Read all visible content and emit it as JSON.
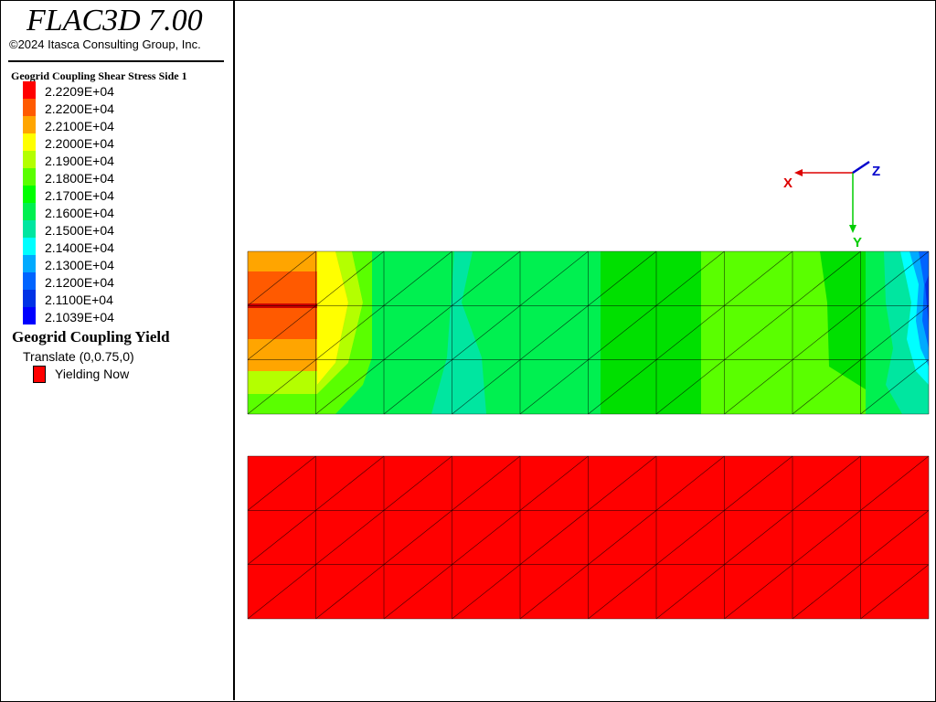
{
  "app": {
    "title": "FLAC3D 7.00",
    "copyright": "©2024 Itasca Consulting Group, Inc."
  },
  "contour_legend": {
    "heading": "Geogrid Coupling Shear Stress Side 1",
    "levels": [
      {
        "label": "2.2209E+04",
        "color": "#ff0000"
      },
      {
        "label": "2.2200E+04",
        "color": "#ff5a00"
      },
      {
        "label": "2.2100E+04",
        "color": "#ffa500"
      },
      {
        "label": "2.2000E+04",
        "color": "#ffff00"
      },
      {
        "label": "2.1900E+04",
        "color": "#b4ff00"
      },
      {
        "label": "2.1800E+04",
        "color": "#5aff00"
      },
      {
        "label": "2.1700E+04",
        "color": "#00ff00"
      },
      {
        "label": "2.1600E+04",
        "color": "#00f050"
      },
      {
        "label": "2.1500E+04",
        "color": "#00e6a0"
      },
      {
        "label": "2.1400E+04",
        "color": "#00ffff"
      },
      {
        "label": "2.1300E+04",
        "color": "#00aaff"
      },
      {
        "label": "2.1200E+04",
        "color": "#0064ff"
      },
      {
        "label": "2.1100E+04",
        "color": "#0032e6"
      },
      {
        "label": "2.1039E+04",
        "color": "#0000ff"
      }
    ]
  },
  "yield_legend": {
    "heading": "Geogrid Coupling Yield",
    "translate": "Translate (0,0.75,0)",
    "item_label": "Yielding Now",
    "item_color": "#ff0000"
  },
  "axes": {
    "x_label": "X",
    "y_label": "Y",
    "z_label": "Z",
    "x_color": "#dd0000",
    "y_color": "#00cc00",
    "z_color": "#0000cc"
  }
}
